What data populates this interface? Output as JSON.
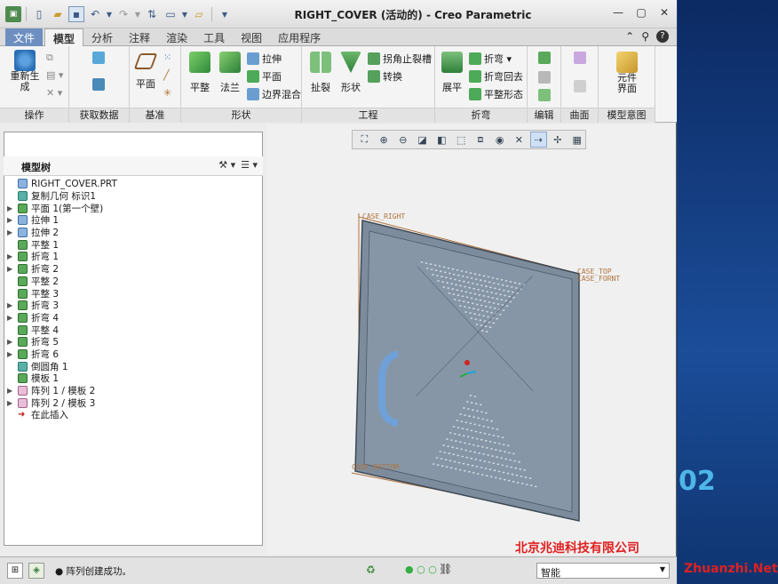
{
  "window": {
    "title": "RIGHT_COVER (活动的) - Creo Parametric"
  },
  "ribbon_tabs": [
    {
      "label": "文件",
      "state": "file"
    },
    {
      "label": "模型",
      "state": "active"
    },
    {
      "label": "分析",
      "state": ""
    },
    {
      "label": "注释",
      "state": ""
    },
    {
      "label": "渲染",
      "state": ""
    },
    {
      "label": "工具",
      "state": ""
    },
    {
      "label": "视图",
      "state": ""
    },
    {
      "label": "应用程序",
      "state": ""
    }
  ],
  "ribbon": {
    "regenerate_label": "重新生成",
    "plane_label": "平面",
    "flatten_label": "平整",
    "flange_label": "法兰",
    "extrude_label": "拉伸",
    "plane_small_label": "平面",
    "boundary_blend_label": "边界混合",
    "rip_label": "扯裂",
    "form_label": "形状",
    "corner_relief_label": "拐角止裂槽",
    "convert_label": "转换",
    "unbend_label": "展平",
    "bend_label": "折弯",
    "bend_back_label": "折弯回去",
    "flat_form_label": "平整形态",
    "component_interface_label": "元件界面",
    "groups": [
      "操作",
      "获取数据",
      "基准",
      "形状",
      "工程",
      "折弯",
      "编辑",
      "曲面",
      "模型意图"
    ]
  },
  "model_tree": {
    "title": "模型树",
    "items": [
      {
        "label": "RIGHT_COVER.PRT",
        "icon": "part-icon",
        "expandable": false,
        "color": "blue"
      },
      {
        "label": "复制几何 标识1",
        "icon": "copy-geometry-icon",
        "expandable": false,
        "color": "teal"
      },
      {
        "label": "平面 1(第一个壁)",
        "icon": "planar-wall-icon",
        "expandable": true,
        "color": "green"
      },
      {
        "label": "拉伸 1",
        "icon": "extrude-icon",
        "expandable": true,
        "color": "blue"
      },
      {
        "label": "拉伸 2",
        "icon": "extrude-icon",
        "expandable": true,
        "color": "blue"
      },
      {
        "label": "平整 1",
        "icon": "flatten-icon",
        "expandable": false,
        "color": "green"
      },
      {
        "label": "折弯 1",
        "icon": "bend-icon",
        "expandable": true,
        "color": "green"
      },
      {
        "label": "折弯 2",
        "icon": "bend-icon",
        "expandable": true,
        "color": "green"
      },
      {
        "label": "平整 2",
        "icon": "flatten-icon",
        "expandable": false,
        "color": "green"
      },
      {
        "label": "平整 3",
        "icon": "flatten-icon",
        "expandable": false,
        "color": "green"
      },
      {
        "label": "折弯 3",
        "icon": "bend-icon",
        "expandable": true,
        "color": "green"
      },
      {
        "label": "折弯 4",
        "icon": "bend-icon",
        "expandable": true,
        "color": "green"
      },
      {
        "label": "平整 4",
        "icon": "flatten-icon",
        "expandable": false,
        "color": "green"
      },
      {
        "label": "折弯 5",
        "icon": "bend-icon",
        "expandable": true,
        "color": "green"
      },
      {
        "label": "折弯 6",
        "icon": "bend-icon",
        "expandable": true,
        "color": "green"
      },
      {
        "label": "倒圆角 1",
        "icon": "round-icon",
        "expandable": false,
        "color": "teal"
      },
      {
        "label": "模板 1",
        "icon": "form-icon",
        "expandable": false,
        "color": "green"
      },
      {
        "label": "阵列 1 / 模板 2",
        "icon": "pattern-icon",
        "expandable": true,
        "color": "pink"
      },
      {
        "label": "阵列 2 / 模板 3",
        "icon": "pattern-icon",
        "expandable": true,
        "color": "pink"
      },
      {
        "label": "在此插入",
        "icon": "insert-here-icon",
        "expandable": false,
        "color": "red"
      }
    ]
  },
  "viewport": {
    "datum_right": "CASE_RIGHT",
    "datum_top": "CASE_TOP",
    "datum_front": "CASE_FORNT",
    "datum_bottom": "CASE_BOTTOM"
  },
  "status": {
    "message": "● 阵列创建成功。",
    "filter_value": "智能"
  },
  "backdrop": {
    "number": "02",
    "watermark_company": "北京兆迪科技有限公司",
    "watermark_site": "Zhuanzhi.Net"
  },
  "colors": {
    "accent": "#6d8fc0",
    "part_body": "#7d8c9c",
    "datum": "#b0723c",
    "backdrop": "#1b4d99"
  }
}
